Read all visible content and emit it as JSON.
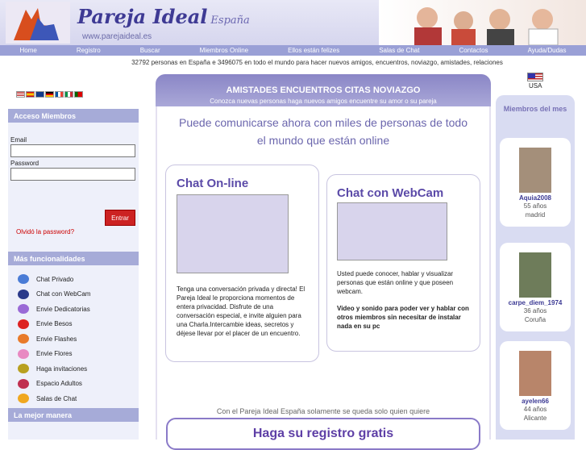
{
  "header": {
    "brand": "Pareja Ideal",
    "country": "España",
    "url": "www.parejaideal.es"
  },
  "nav": [
    "Home",
    "Registro",
    "Buscar",
    "Miembros Online",
    "Ellos están felizes",
    "Salas de Chat",
    "Contactos",
    "Ayuda/Dudas"
  ],
  "stats": "32792 personas en España e 3496075 en todo el mundo para hacer nuevos amigos, encuentros, noviazgo, amistades, relaciones",
  "usa": "USA",
  "sidebar": {
    "login_title": "Acceso Miembros",
    "email_label": "Email",
    "password_label": "Password",
    "enter": "Entrar",
    "forgot": "Olvidó la password?",
    "more_title": "Más funcionalidades",
    "features": [
      {
        "label": "Chat Privado",
        "color": "#4a7cd6"
      },
      {
        "label": "Chat con WebCam",
        "color": "#2a3a8a"
      },
      {
        "label": "Envie Dedicatorias",
        "color": "#9a6ad6"
      },
      {
        "label": "Envie Besos",
        "color": "#d22"
      },
      {
        "label": "Envie Flashes",
        "color": "#e87a2a"
      },
      {
        "label": "Envie Flores",
        "color": "#e889c2"
      },
      {
        "label": "Haga invitaciones",
        "color": "#b8a020"
      },
      {
        "label": "Espacio Adultos",
        "color": "#c03050"
      },
      {
        "label": "Salas de Chat",
        "color": "#f0a820"
      }
    ],
    "best_title": "La mejor manera"
  },
  "main": {
    "banner_title": "AMISTADES ENCUENTROS CITAS NOVIAZGO",
    "banner_sub": "Conozca nuevas personas haga nuevos amigos encuentre su amor o su pareja",
    "intro": "Puede comunicarse ahora con miles de personas de todo el mundo que están online",
    "chat_title": "Chat On-line",
    "chat_text": "Tenga una conversación privada y directa! El Pareja Ideal le proporciona momentos de entera privacidad. Disfrute de una conversación especial, e invite alguien para una Charla.Intercambie ideas, secretos y déjese llevar por el placer de un encuentro.",
    "webcam_title": "Chat con WebCam",
    "webcam_text": "Usted puede conocer, hablar y visualizar personas que están online y que poseen webcam.",
    "webcam_text2": "Video y sonido para poder ver y hablar con otros miembros sin necesitar de instalar nada en su pc",
    "footer_note": "Con el Pareja Ideal España solamente se queda solo quien quiere",
    "register": "Haga su registro gratis"
  },
  "members": {
    "title": "Miembros del mes",
    "list": [
      {
        "name": "Aquia2008",
        "age": "55 años",
        "city": "madrid"
      },
      {
        "name": "carpe_diem_1974",
        "age": "36 años",
        "city": "Coruña"
      },
      {
        "name": "ayelen66",
        "age": "44 años",
        "city": "Alicante"
      }
    ]
  }
}
